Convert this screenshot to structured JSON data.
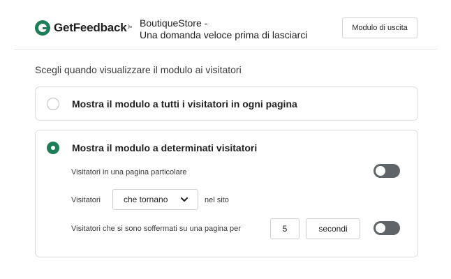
{
  "header": {
    "logo_text": "GetFeedback",
    "logo_tm": "™",
    "breadcrumb_separator": "›",
    "breadcrumb_line1": "BoutiqueStore -",
    "breadcrumb_line2": "Una domanda veloce prima di lasciarci",
    "exit_button": "Modulo di uscita"
  },
  "main": {
    "question": "Scegli quando visualizzare il modulo ai visitatori",
    "option_all": {
      "label": "Mostra il modulo a tutti i visitatori in ogni pagina",
      "selected": false
    },
    "option_specific": {
      "label": "Mostra il modulo a determinati visitatori",
      "selected": true,
      "rules": {
        "particular_page_label": "Visitatori in una pagina particolare",
        "particular_page_enabled": false,
        "visitors_prefix": "Visitatori",
        "visitors_select_value": "che tornano",
        "visitors_suffix": "nel sito",
        "dwell_label": "Visitatori che si sono soffermati su una pagina per",
        "dwell_value": "5",
        "dwell_unit": "secondi",
        "dwell_enabled": false
      }
    }
  },
  "colors": {
    "brand_green": "#1e7e57",
    "toggle_off": "#5f6468"
  }
}
